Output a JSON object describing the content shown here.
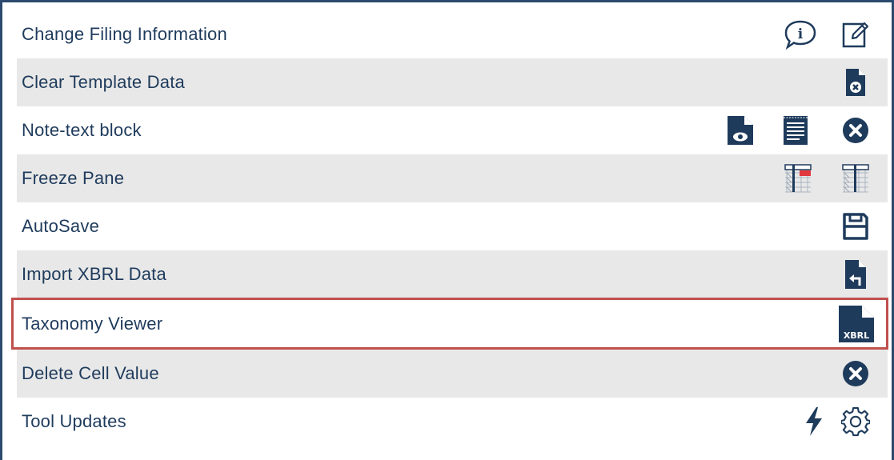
{
  "menu": {
    "items": [
      {
        "label": "Change Filing Information",
        "icons": [
          "info-bubble-icon",
          "edit-icon"
        ]
      },
      {
        "label": "Clear Template Data",
        "icons": [
          "clear-document-icon"
        ]
      },
      {
        "label": "Note-text block",
        "icons": [
          "preview-document-icon",
          "text-block-icon",
          "close-circle-icon"
        ]
      },
      {
        "label": "Freeze Pane",
        "icons": [
          "freeze-pane-icon",
          "unfreeze-pane-icon"
        ]
      },
      {
        "label": "AutoSave",
        "icons": [
          "save-icon"
        ]
      },
      {
        "label": "Import XBRL Data",
        "icons": [
          "import-document-icon"
        ]
      },
      {
        "label": "Taxonomy Viewer",
        "icons": [
          "xbrl-document-icon"
        ],
        "highlighted": true
      },
      {
        "label": "Delete Cell Value",
        "icons": [
          "close-circle-icon"
        ]
      },
      {
        "label": "Tool Updates",
        "icons": [
          "lightning-icon",
          "gear-icon"
        ]
      }
    ]
  },
  "icon_text": {
    "xbrl": "XBRL",
    "info": "i"
  },
  "colors": {
    "label": "#1f3b5c",
    "icon": "#1f3b5c",
    "shade": "#e8e8e8",
    "highlight": "#c0504d",
    "border": "#2b4a6e"
  }
}
